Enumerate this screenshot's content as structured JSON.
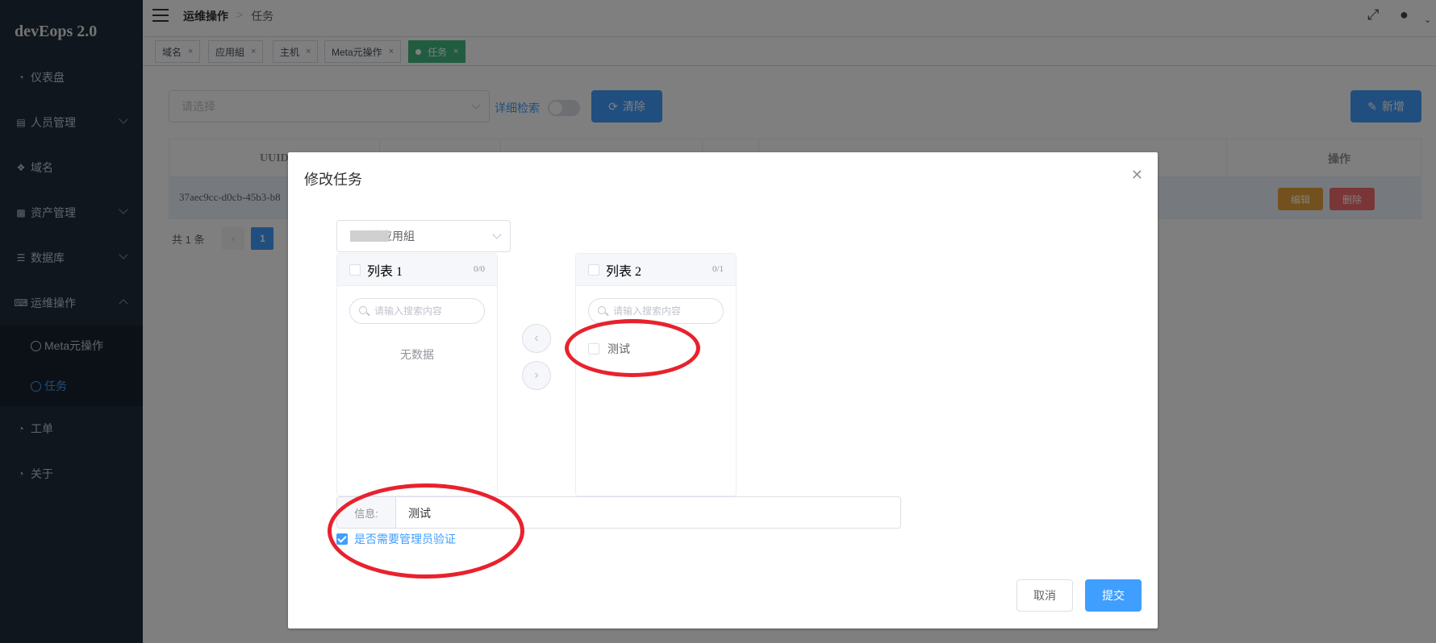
{
  "app": {
    "logo": "devEops 2.0"
  },
  "sidebar": {
    "items": [
      {
        "label": "仪表盘",
        "icon": "dashboard-icon"
      },
      {
        "label": "人员管理",
        "icon": "id-card-icon"
      },
      {
        "label": "域名",
        "icon": "cube-icon"
      },
      {
        "label": "资产管理",
        "icon": "truck-icon"
      },
      {
        "label": "数据库",
        "icon": "database-icon"
      },
      {
        "label": "运维操作",
        "icon": "keyboard-icon"
      },
      {
        "label": "工单",
        "icon": "dashboard-icon"
      },
      {
        "label": "关于",
        "icon": "dashboard-icon"
      }
    ],
    "subitems": [
      {
        "label": "Meta元操作"
      },
      {
        "label": "任务"
      }
    ]
  },
  "header": {
    "breadcrumb": {
      "first": "运维操作",
      "sep": ">",
      "last": "任务"
    }
  },
  "tags": [
    {
      "label": "域名"
    },
    {
      "label": "应用組"
    },
    {
      "label": "主机"
    },
    {
      "label": "Meta元操作"
    },
    {
      "label": "任务"
    }
  ],
  "toolbar": {
    "select_placeholder": "请选择",
    "detail_search_label": "详细检索",
    "clear_label": "清除",
    "add_label": "新增"
  },
  "table": {
    "headers": {
      "uuid": "UUID",
      "actions": "操作"
    },
    "rows": [
      {
        "uuid": "37aec9cc-d0cb-45b3-b8"
      }
    ],
    "edit_label": "编辑",
    "delete_label": "删除"
  },
  "pagination": {
    "total_text": "共 1 条",
    "current": "1"
  },
  "dialog": {
    "title": "修改任务",
    "group_select_value": "式应用組",
    "list1": {
      "title": "列表 1",
      "count": "0/0",
      "search_placeholder": "请输入搜索内容",
      "empty": "无数据"
    },
    "list2": {
      "title": "列表 2",
      "count": "0/1",
      "search_placeholder": "请输入搜索内容",
      "items": [
        "测试"
      ]
    },
    "info_label": "信息:",
    "info_value": "测试",
    "verify_label": "是否需要管理员验证",
    "cancel_label": "取消",
    "submit_label": "提交"
  },
  "colors": {
    "sidebar": "#1f2d3d",
    "primary": "#409eff",
    "active_tag": "#42b983",
    "annotation": "#e8222d"
  }
}
